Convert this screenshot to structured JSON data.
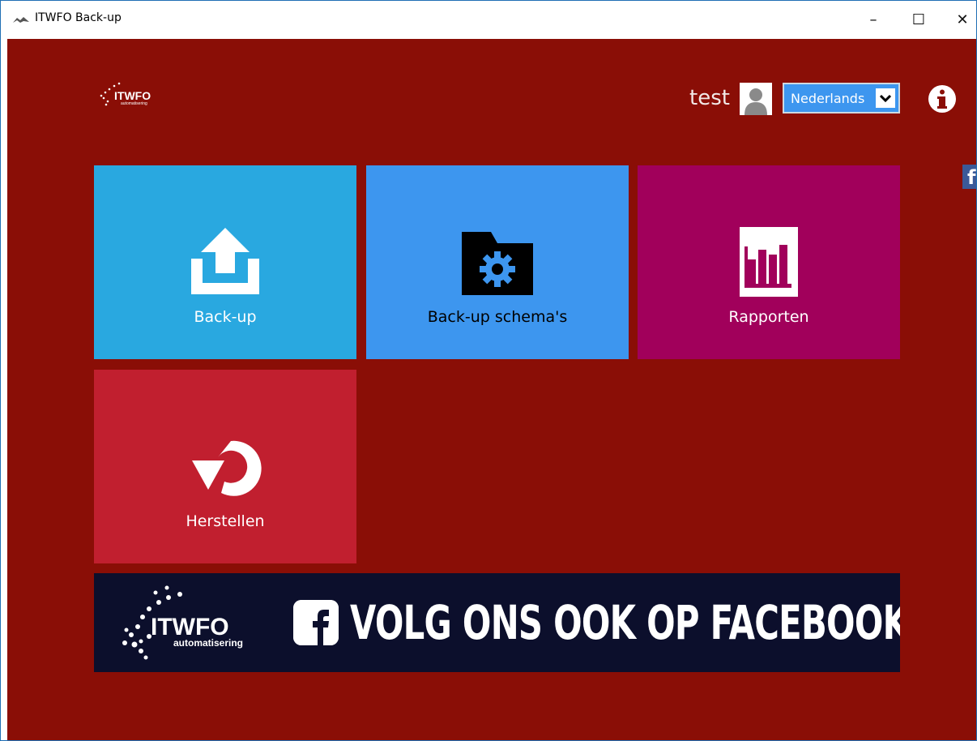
{
  "window": {
    "title": "ITWFO Back-up",
    "controls": {
      "minimize": "–",
      "maximize": "☐",
      "close": "✕"
    }
  },
  "header": {
    "logo_text": "ITWFO",
    "logo_subtext": "automatisering",
    "user_name": "test",
    "language_selected": "Nederlands"
  },
  "tiles": [
    {
      "label": "Back-up",
      "icon": "upload-icon",
      "color": "#29a8e0"
    },
    {
      "label": "Back-up schema's",
      "icon": "folder-gear-icon",
      "color": "#3d96ef"
    },
    {
      "label": "Rapporten",
      "icon": "report-chart-icon",
      "color": "#a1005b"
    },
    {
      "label": "Herstellen",
      "icon": "restore-icon",
      "color": "#c11f2f"
    }
  ],
  "banner": {
    "logo_text": "ITWFO",
    "logo_subtext": "automatisering",
    "text": "VOLG ONS OOK OP FACEBOOK!"
  },
  "colors": {
    "background": "#8a0e06",
    "banner": "#0c0f2c",
    "facebook": "#3b5998"
  }
}
